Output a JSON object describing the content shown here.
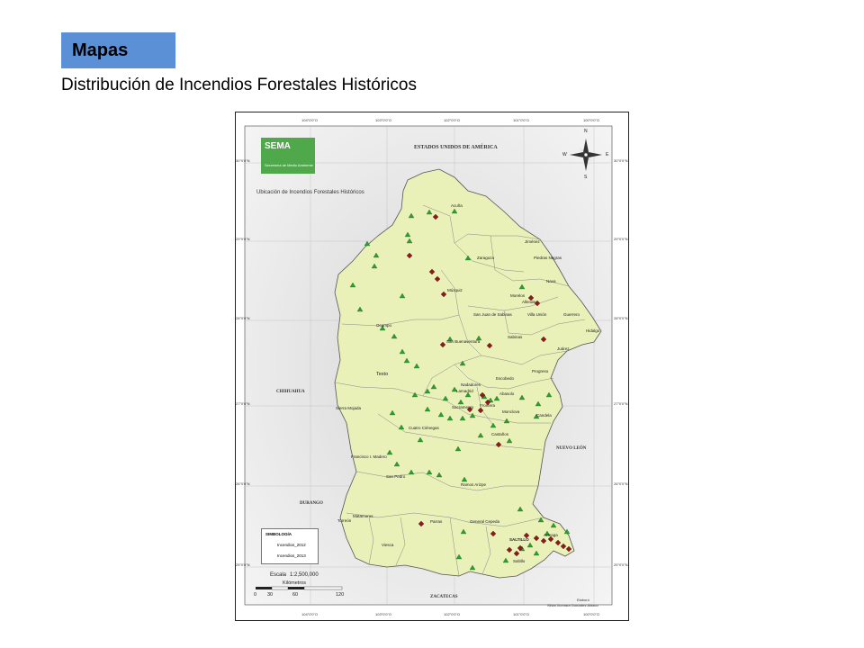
{
  "header": {
    "tag": "Mapas",
    "subtitle": "Distribución de Incendios Forestales Históricos"
  },
  "map": {
    "logo_text": "SEMA",
    "logo_subtext": "Secretaría de Medio Ambiente",
    "title": "Ubicación de Incendios Forestales Históricos",
    "country_label": "ESTADOS UNIDOS DE AMÉRICA",
    "states": {
      "chihuahua": "CHIHUAHUA",
      "durango": "DURANGO",
      "nuevo_leon": "NUEVO LEÓN",
      "zacatecas": "ZACATECAS"
    },
    "municipalities": {
      "acuna": "Acuña",
      "jimenez": "Jiménez",
      "piedras_negras": "Piedras Negras",
      "zaragoza": "Zaragoza",
      "nava": "Nava",
      "muzquiz": "Múzquiz",
      "morelos": "Morelos",
      "allende": "Allende",
      "villa_union": "Villa Unión",
      "guerrero": "Guerrero",
      "san_juan_sabinas": "San Juan de Sabinas",
      "ocampo": "Ocampo",
      "hidalgo": "Hidalgo",
      "sabinas": "Sabinas",
      "san_buenaventura": "San Buenaventura",
      "juarez": "Juárez",
      "progreso": "Progreso",
      "texto": "Texto",
      "escobedo": "Escobedo",
      "nadadores": "Nadadores",
      "lamadrid": "Lamadrid",
      "abasolo": "Abasolo",
      "sacramento": "Sacramento",
      "frontera": "Frontera",
      "monclova": "Monclova",
      "candela": "Candela",
      "sierra_mojada": "Sierra Mojada",
      "cuatro_cienegas": "Cuatro Ciénegas",
      "castanos": "Castaños",
      "francisco_madero": "Francisco I. Madero",
      "san_pedro": "San Pedro",
      "ramos_arizpe": "Ramos Arizpe",
      "matamoros": "Matamoros",
      "torreon": "Torreón",
      "general_cepeda": "General Cepeda",
      "parras": "Parras",
      "saltillo_main": "SALTILLO",
      "arteaga": "Arteaga",
      "viesca": "Viesca",
      "saltillo": "Saltillo"
    },
    "legend": {
      "title": "SIMBOLOGÍA",
      "item_2012": "Incendios_2012",
      "item_2013": "Incendios_2013"
    },
    "scale": {
      "label": "Escala",
      "ratio": "1:2,500,000",
      "units": "Kilómetros",
      "ticks": [
        "0",
        "30",
        "60",
        "120"
      ]
    },
    "credit": {
      "line1": "Elaboró",
      "line2": "Silvia Xiomara González Aldaco"
    },
    "longitudes": [
      "104°0'0\"O",
      "103°0'0\"O",
      "102°0'0\"O",
      "101°0'0\"O",
      "100°0'0\"O"
    ],
    "latitudes": [
      "30°0'0\"N",
      "29°0'0\"N",
      "28°0'0\"N",
      "27°0'0\"N",
      "26°0'0\"N",
      "25°0'0\"N"
    ],
    "compass": {
      "n": "N",
      "s": "S",
      "e": "E",
      "w": "W"
    },
    "colors": {
      "state_fill": "#e9f0b8",
      "border": "#555555",
      "fire_2012": "#2e9e2e",
      "fire_2013": "#8b1a1a",
      "logo_green": "#4fa84a",
      "tag_blue": "#5b8fd6"
    }
  }
}
